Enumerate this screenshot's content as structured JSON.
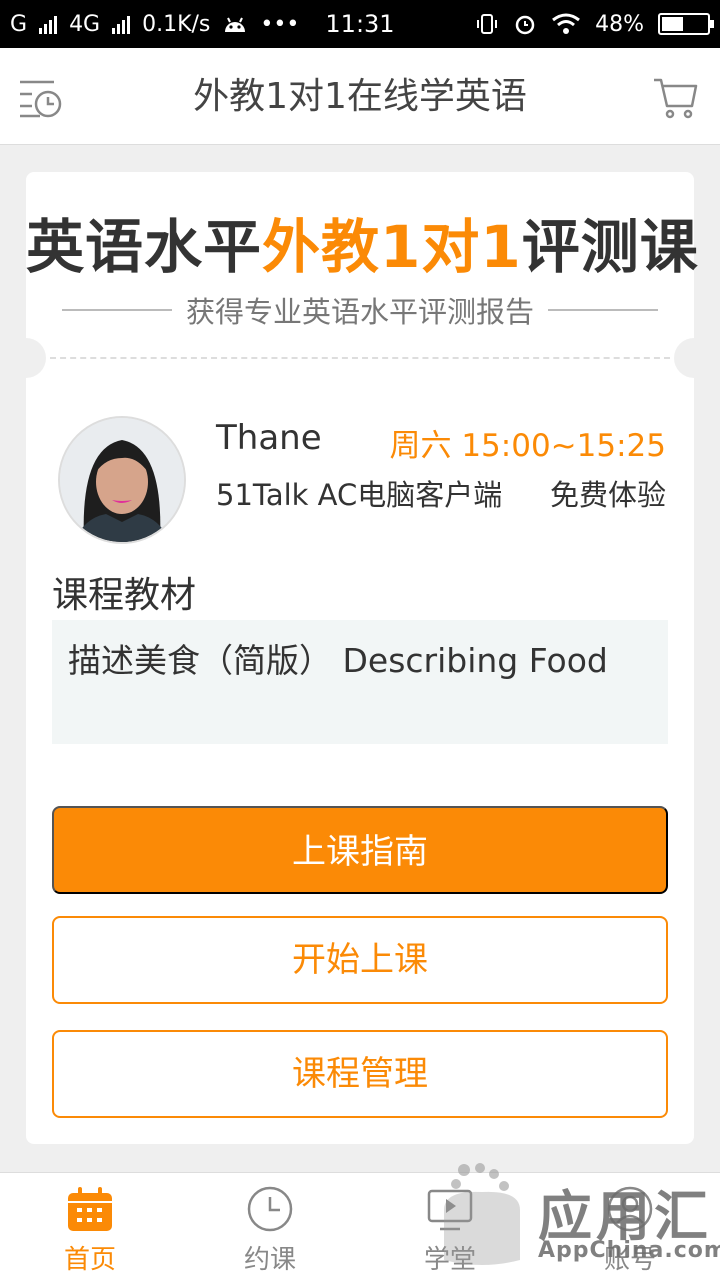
{
  "status_bar": {
    "carrier": "G",
    "network": "4G",
    "speed": "0.1K/s",
    "more": "•••",
    "time": "11:31",
    "battery": "48%",
    "battery_level": 0.48
  },
  "header": {
    "title": "外教1对1在线学英语",
    "left_icon": "history-clock-icon",
    "right_icon": "cart-icon"
  },
  "banner": {
    "title_part1": "英语水平",
    "title_highlight": "外教1对1",
    "title_part2": "评测课",
    "subtitle": "获得专业英语水平评测报告"
  },
  "lesson": {
    "teacher_name": "Thane",
    "time_slot": "周六 15:00~15:25",
    "client": "51Talk AC电脑客户端",
    "trial_label": "免费体验"
  },
  "material": {
    "section_label": "课程教材",
    "name": "描述美食（简版） Describing Food"
  },
  "buttons": {
    "guide": "上课指南",
    "start": "开始上课",
    "manage": "课程管理"
  },
  "tabbar": {
    "items": [
      {
        "label": "首页",
        "icon": "calendar-grid-icon",
        "active": true
      },
      {
        "label": "约课",
        "icon": "clock-icon",
        "active": false
      },
      {
        "label": "学堂",
        "icon": "play-screen-icon",
        "active": false
      },
      {
        "label": "账号",
        "icon": "user-icon",
        "active": false
      }
    ]
  },
  "watermark": {
    "text": "应用汇",
    "sub": "AppChina.com"
  },
  "colors": {
    "accent": "#fb8a06",
    "background": "#efefef",
    "material_bg": "#f2f6f6"
  }
}
